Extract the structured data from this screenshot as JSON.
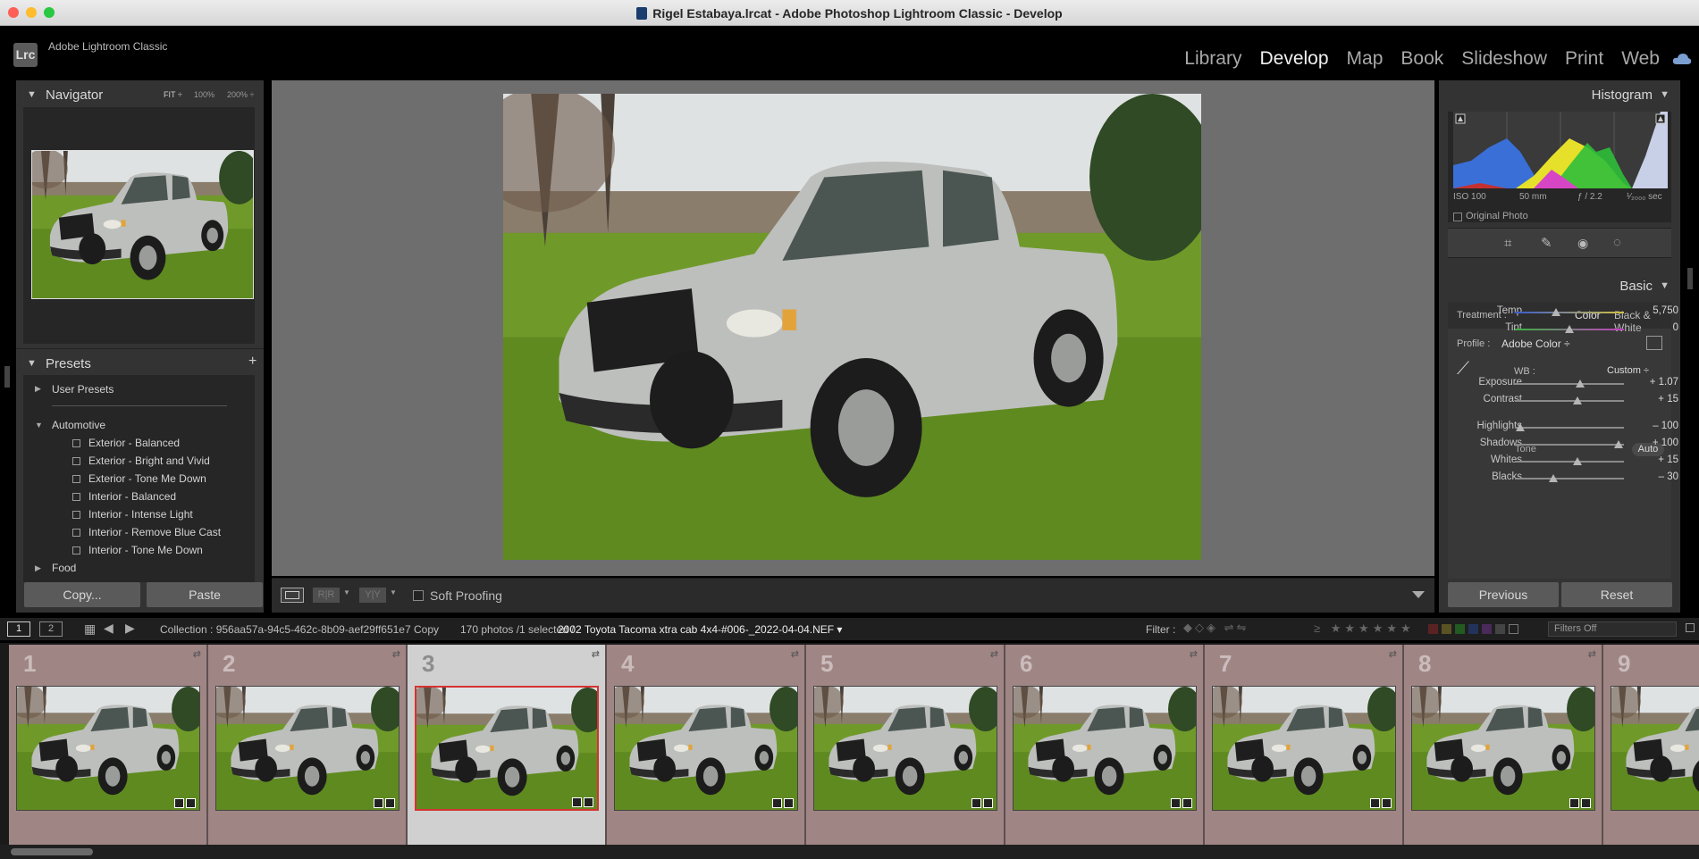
{
  "window": {
    "title": "Rigel Estabaya.lrcat - Adobe Photoshop Lightroom Classic - Develop"
  },
  "app": {
    "logo": "Lrc",
    "name": "Adobe Lightroom Classic"
  },
  "modules": [
    "Library",
    "Develop",
    "Map",
    "Book",
    "Slideshow",
    "Print",
    "Web"
  ],
  "navigator": {
    "title": "Navigator",
    "zoom_options": [
      "FIT ÷",
      "100%",
      "200% ÷"
    ]
  },
  "presets": {
    "title": "Presets",
    "groups": [
      {
        "label": "User Presets",
        "expanded": false
      },
      {
        "label": "Automotive",
        "expanded": true,
        "items": [
          "Exterior - Balanced",
          "Exterior - Bright and Vivid",
          "Exterior - Tone Me Down",
          "Interior - Balanced",
          "Interior - Intense Light",
          "Interior - Remove Blue Cast",
          "Interior - Tone Me Down"
        ]
      },
      {
        "label": "Food",
        "expanded": false
      }
    ]
  },
  "left_buttons": {
    "copy": "Copy...",
    "paste": "Paste"
  },
  "toolbar": {
    "soft_proofing": "Soft Proofing"
  },
  "histogram": {
    "title": "Histogram",
    "iso": "ISO 100",
    "focal": "50 mm",
    "aperture": "ƒ / 2.2",
    "shutter": "¹⁄₂₀₀₀ sec",
    "original_photo": "Original Photo"
  },
  "basic": {
    "title": "Basic",
    "treatment_label": "Treatment :",
    "color": "Color",
    "bw": "Black & White",
    "profile_label": "Profile :",
    "profile_value": "Adobe Color ÷",
    "wb_label": "WB :",
    "wb_value": "Custom ÷",
    "tone_label": "Tone",
    "auto": "Auto",
    "sliders": [
      {
        "label": "Temp",
        "value": "5,750",
        "pos": 0.38
      },
      {
        "label": "Tint",
        "value": "0",
        "pos": 0.5
      },
      {
        "label": "Exposure",
        "value": "+ 1.07",
        "pos": 0.6
      },
      {
        "label": "Contrast",
        "value": "+ 15",
        "pos": 0.57
      },
      {
        "label": "Highlights",
        "value": "– 100",
        "pos": 0.05
      },
      {
        "label": "Shadows",
        "value": "+ 100",
        "pos": 0.95
      },
      {
        "label": "Whites",
        "value": "+ 15",
        "pos": 0.57
      },
      {
        "label": "Blacks",
        "value": "– 30",
        "pos": 0.35
      }
    ]
  },
  "right_buttons": {
    "previous": "Previous",
    "reset": "Reset"
  },
  "filmstrip_bar": {
    "page1": "1",
    "page2": "2",
    "collection": "Collection : 956aa57a-94c5-462c-8b09-aef29ff651e7 Copy",
    "count": "170 photos /1 selected /",
    "filename": "2002 Toyota Tacoma xtra cab 4x4-#006-_2022-04-04.NEF ▾",
    "filter_label": "Filter :",
    "filters_off": "Filters Off"
  },
  "filmstrip": [
    "1",
    "2",
    "3",
    "4",
    "5",
    "6",
    "7",
    "8",
    "9"
  ],
  "colors": {
    "selected_border": "#d43232",
    "cell_bg": "#a08585"
  }
}
